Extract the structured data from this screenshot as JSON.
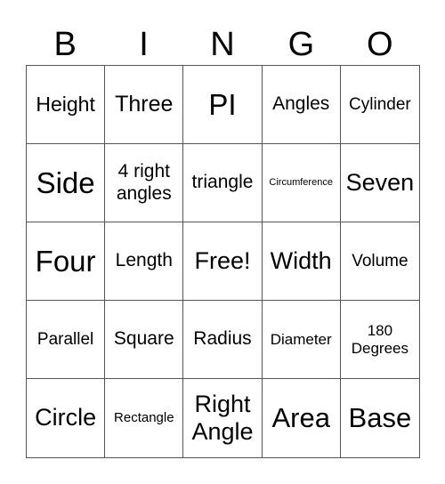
{
  "header": [
    "B",
    "I",
    "N",
    "G",
    "O"
  ],
  "cells": [
    "Height",
    "Three",
    "PI",
    "Angles",
    "Cylinder",
    "Side",
    "4 right angles",
    "triangle",
    "Circumference",
    "Seven",
    "Four",
    "Length",
    "Free!",
    "Width",
    "Volume",
    "Parallel",
    "Square",
    "Radius",
    "Diameter",
    "180 Degrees",
    "Circle",
    "Rectangle",
    "Right Angle",
    "Area",
    "Base"
  ]
}
